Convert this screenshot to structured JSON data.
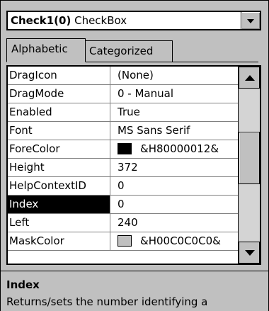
{
  "object_combo": {
    "name": "Check1(0)",
    "type": "CheckBox",
    "icon": "chevron-down-icon"
  },
  "tabs": [
    {
      "label": "Alphabetic",
      "active": true
    },
    {
      "label": "Categorized",
      "active": false
    }
  ],
  "properties": [
    {
      "name": "DragIcon",
      "value": "(None)"
    },
    {
      "name": "DragMode",
      "value": "0 - Manual"
    },
    {
      "name": "Enabled",
      "value": "True"
    },
    {
      "name": "Font",
      "value": "MS Sans Serif"
    },
    {
      "name": "ForeColor",
      "value": "&H80000012&",
      "swatch": "#000000"
    },
    {
      "name": "Height",
      "value": "372"
    },
    {
      "name": "HelpContextID",
      "value": "0"
    },
    {
      "name": "Index",
      "value": "0",
      "selected": true
    },
    {
      "name": "Left",
      "value": "240"
    },
    {
      "name": "MaskColor",
      "value": "&H00C0C0C0&",
      "swatch": "#c0c0c0"
    }
  ],
  "description": {
    "title": "Index",
    "text": "Returns/sets the number identifying a"
  },
  "colors": {
    "selection": "#000000",
    "panel": "#c0c0c0"
  }
}
